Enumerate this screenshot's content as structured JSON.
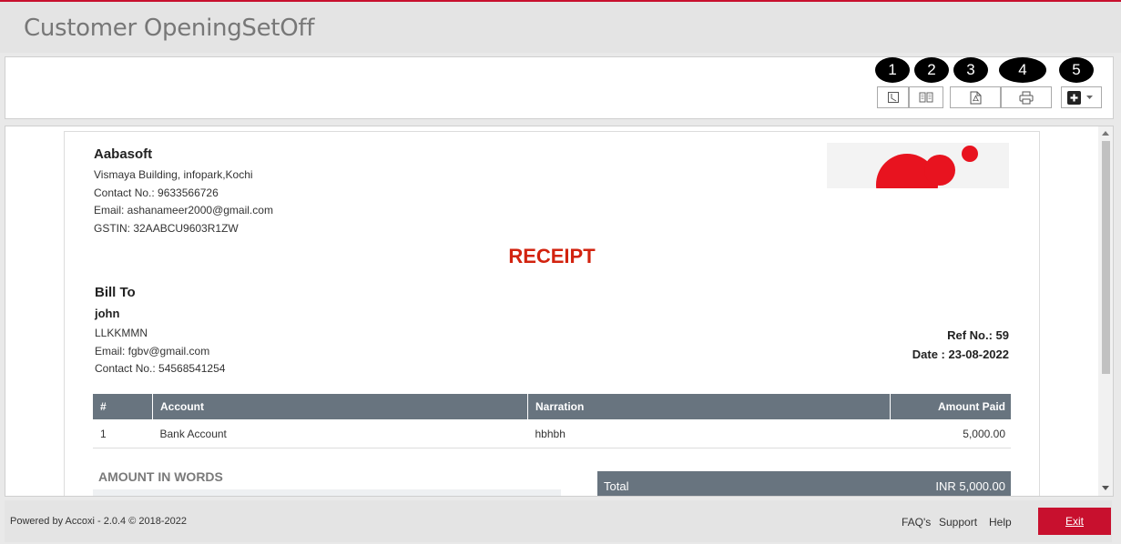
{
  "app": {
    "title": "Customer OpeningSetOff",
    "accent": "#c8102e"
  },
  "toolbar": {
    "badges": [
      "1",
      "2",
      "3",
      "4",
      "5"
    ],
    "icons": [
      "history-icon",
      "book-icon",
      "pdf-icon",
      "printer-icon",
      "plus-square-icon",
      "caret-down-icon"
    ]
  },
  "company": {
    "name": "Aabasoft",
    "address": "Vismaya Building, infopark,Kochi",
    "contact": "Contact No.: 9633566726",
    "email": "Email: ashanameer2000@gmail.com",
    "gstin": "GSTIN: 32AABCU9603R1ZW"
  },
  "doc": {
    "title": "RECEIPT",
    "title_color": "#d2230f"
  },
  "bill_to": {
    "heading": "Bill To",
    "name": "john",
    "line1": "LLKKMMN",
    "email": "Email: fgbv@gmail.com",
    "contact": "Contact No.: 54568541254"
  },
  "ref": {
    "ref_no": "Ref No.: 59",
    "date": "Date : 23-08-2022"
  },
  "table": {
    "headers": [
      "#",
      "Account",
      "Narration",
      "Amount Paid"
    ],
    "rows": [
      [
        "1",
        "Bank Account",
        "hbhbh",
        "5,000.00"
      ]
    ],
    "header_color": "#68747f"
  },
  "amount_in_words": {
    "label": "AMOUNT IN WORDS"
  },
  "total": {
    "label": "Total",
    "value": "INR 5,000.00"
  },
  "footer": {
    "powered": "Powered by Accoxi - 2.0.4 © 2018-2022",
    "links": [
      "FAQ's",
      "Support",
      "Help"
    ],
    "exit": "Exit"
  }
}
